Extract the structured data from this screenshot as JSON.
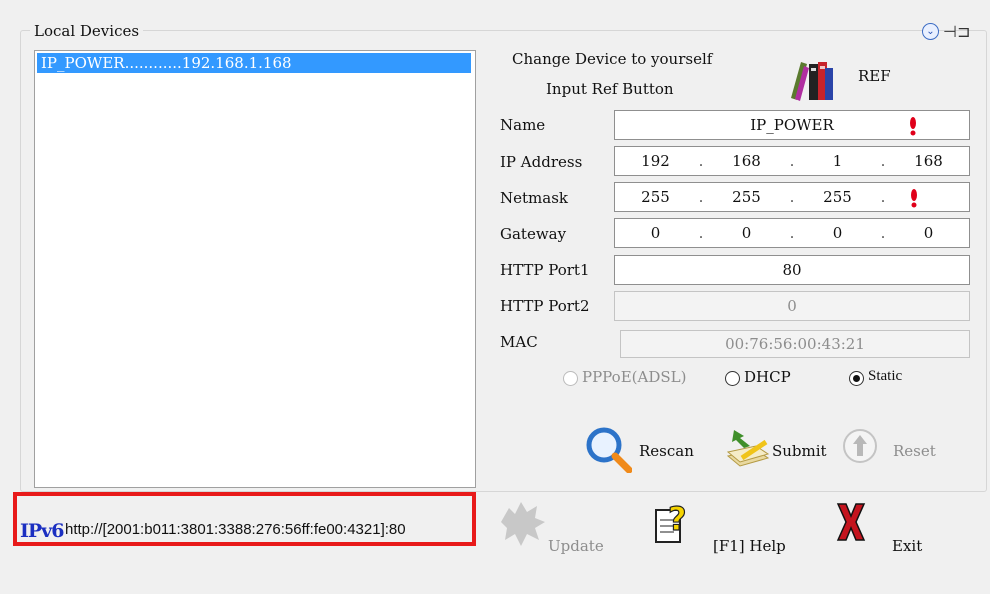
{
  "group": {
    "title": "Local Devices"
  },
  "devices": [
    {
      "label": "IP_POWER............192.168.1.168"
    }
  ],
  "header": {
    "change_text": "Change Device to yourself",
    "input_ref_text": "Input Ref Button",
    "ref_label": "REF"
  },
  "fields": {
    "name": {
      "label": "Name",
      "value": "IP_POWER"
    },
    "ip_address": {
      "label": "IP Address",
      "octets": [
        "192",
        "168",
        "1",
        "168"
      ]
    },
    "netmask": {
      "label": "Netmask",
      "octets": [
        "255",
        "255",
        "255",
        ""
      ]
    },
    "gateway": {
      "label": "Gateway",
      "octets": [
        "0",
        "0",
        "0",
        "0"
      ]
    },
    "http_port1": {
      "label": "HTTP Port1",
      "value": "80"
    },
    "http_port2": {
      "label": "HTTP Port2",
      "value": "0"
    },
    "mac": {
      "label": "MAC",
      "value": "00:76:56:00:43:21"
    }
  },
  "mode": {
    "pppoe": "PPPoE(ADSL)",
    "dhcp": "DHCP",
    "static": "Static",
    "selected": "Static"
  },
  "actions": {
    "rescan": "Rescan",
    "submit": "Submit",
    "reset": "Reset",
    "update": "Update",
    "help": "[F1] Help",
    "exit": "Exit"
  },
  "ipv6": {
    "logo": "IPv6",
    "url": "http://[2001:b011:3801:3388:276:56ff:fe00:4321]:80"
  },
  "colors": {
    "selection": "#3399ff",
    "highlight_border": "#e81a1a",
    "ipv6_logo": "#1b2fc1"
  }
}
